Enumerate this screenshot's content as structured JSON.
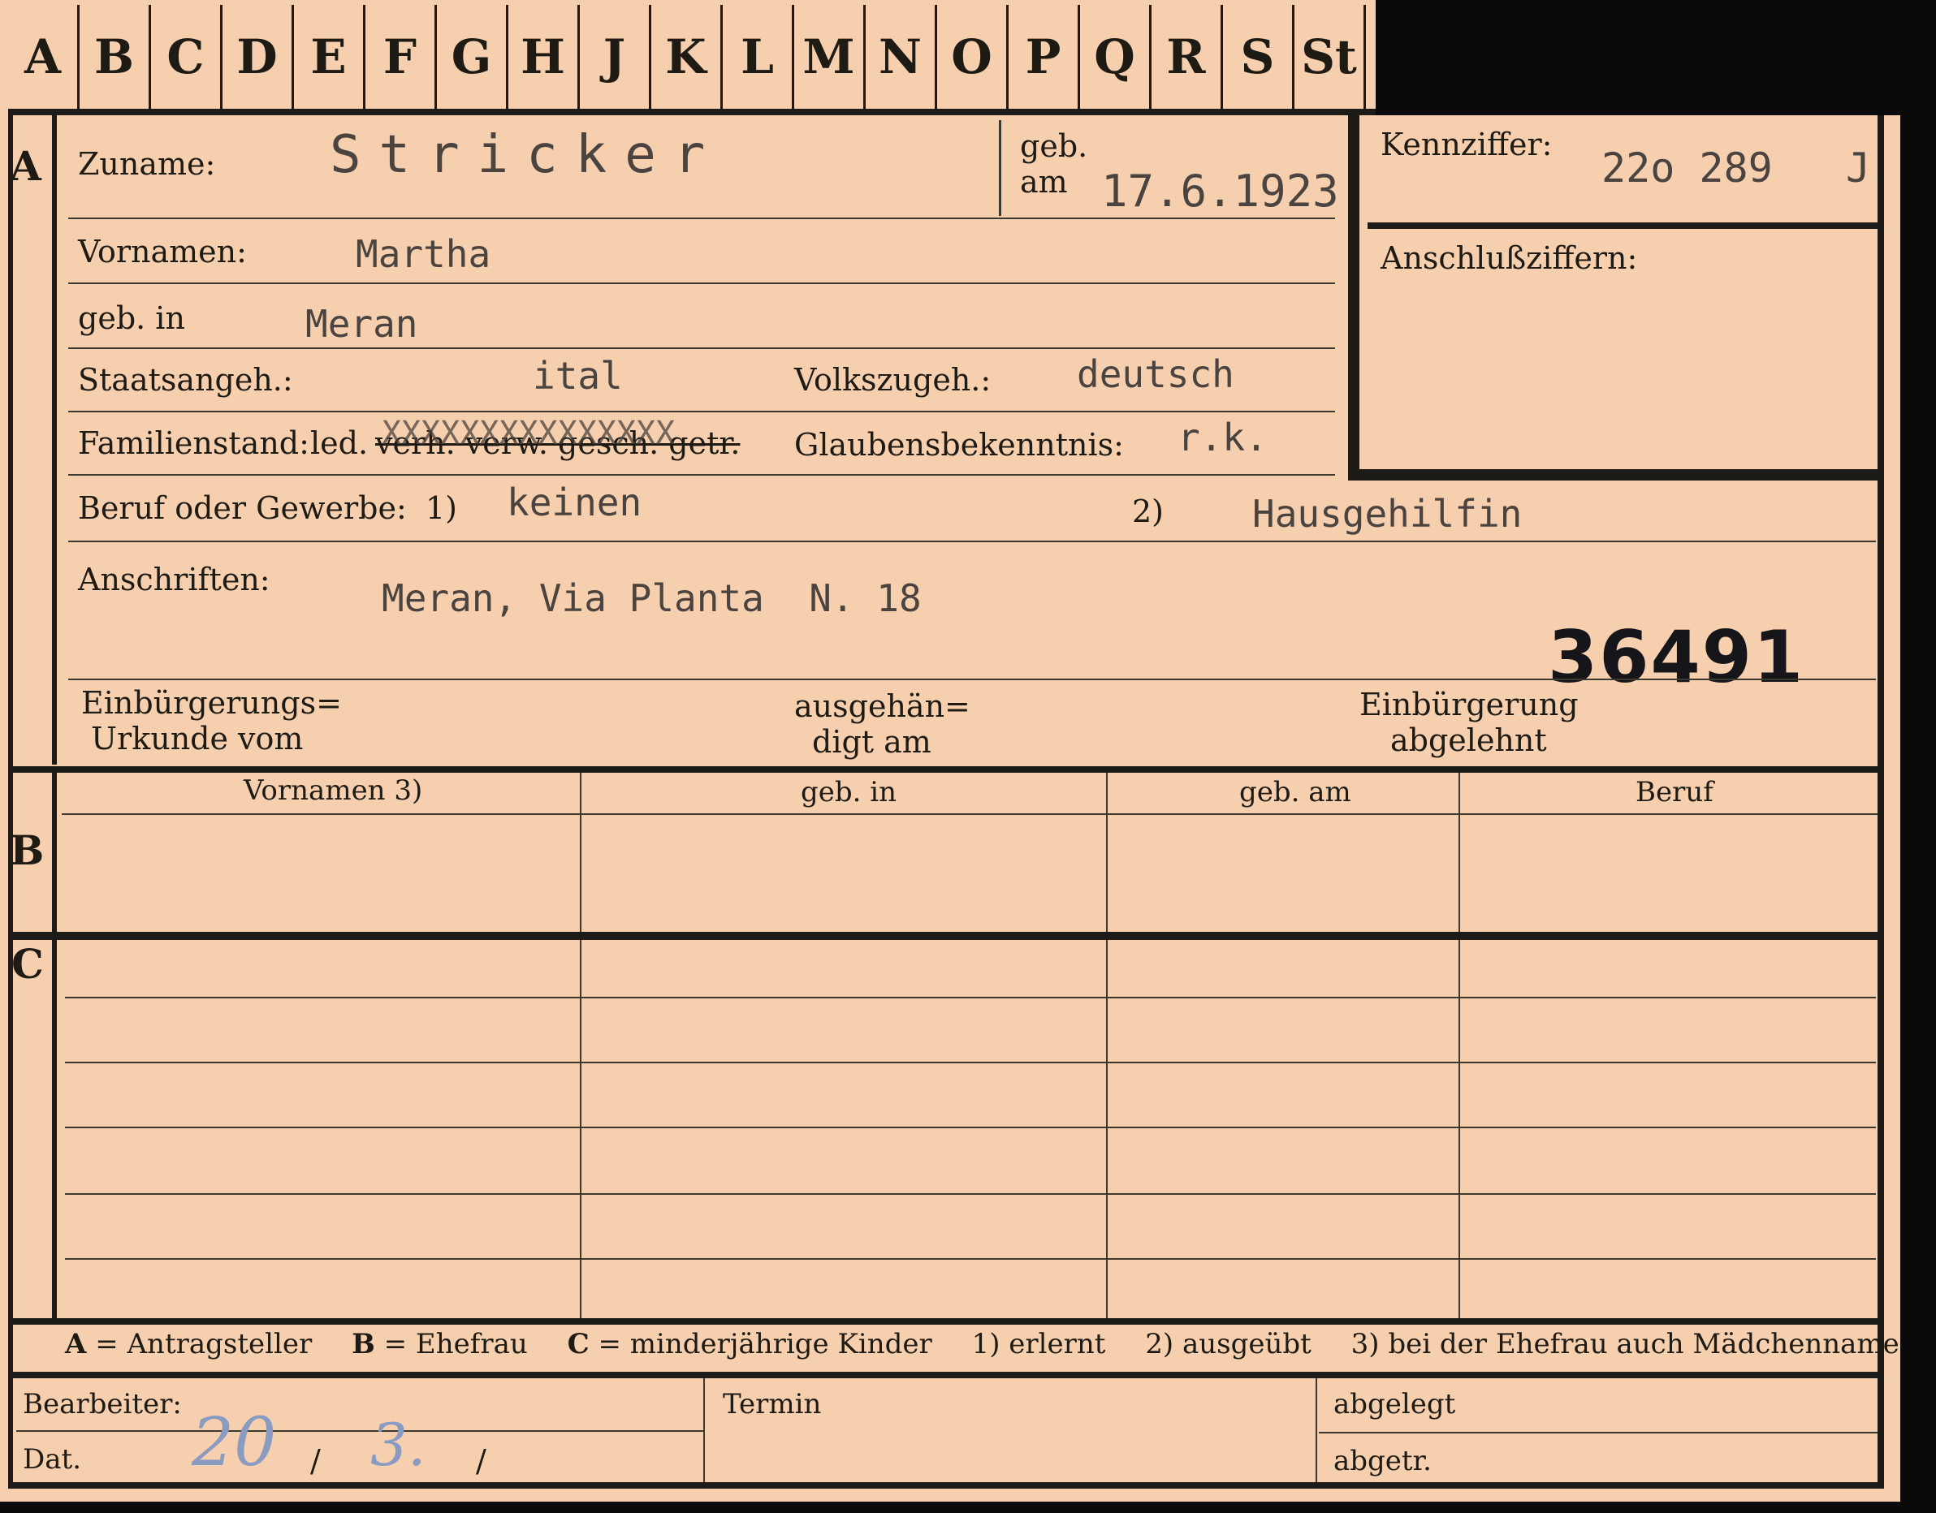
{
  "tabs": [
    "A",
    "B",
    "C",
    "D",
    "E",
    "F",
    "G",
    "H",
    "J",
    "K",
    "L",
    "M",
    "N",
    "O",
    "P",
    "Q",
    "R",
    "S",
    "St"
  ],
  "side_labels": {
    "a": "A",
    "b": "B",
    "c": "C"
  },
  "labels": {
    "zuname": "Zuname:",
    "geb_am": "geb.",
    "geb_am_2": "am",
    "kennziffer": "Kennziffer:",
    "anschlussziffern": "Anschlußziffern:",
    "vornamen": "Vornamen:",
    "geb_in": "geb. in",
    "staatsangeh": "Staatsangeh.:",
    "volkszugeh": "Volkszugeh.:",
    "familienstand": "Familienstand:",
    "familienstand_option": "led.",
    "familienstand_struck": "verh. verw. gesch. getr.",
    "glaubensbekenntnis": "Glaubensbekenntnis:",
    "beruf": "Beruf oder Gewerbe:",
    "beruf_note1": "1)",
    "beruf_note2": "2)",
    "anschriften": "Anschriften:",
    "einbuergerung_1": "Einbürgerungs=",
    "einbuergerung_2": "Urkunde vom",
    "ausgehaend_1": "ausgehän=",
    "ausgehaend_2": "digt am",
    "abgelehnt_1": "Einbürgerung",
    "abgelehnt_2": "abgelehnt"
  },
  "values": {
    "zuname": "Stricker",
    "geb_am": "17.6.1923.",
    "kennziffer": "22o 289   J",
    "vornamen": "Martha",
    "geb_in": "Meran",
    "staatsangeh": "ital",
    "volkszugeh": "deutsch",
    "familienstand_overwrite": "XXXXXXXXXXXXXXX",
    "glaubensbekenntnis": "r.k.",
    "beruf_erlernt": "keinen",
    "beruf_ausgeuebt": "Hausgehilfin",
    "anschrift": "Meran, Via Planta  N. 18",
    "stamp_number": "36491"
  },
  "table": {
    "headers": [
      "Vornamen 3)",
      "geb. in",
      "geb. am",
      "Beruf"
    ]
  },
  "legend": {
    "a_key": "A",
    "a_val": "= Antragsteller",
    "b_key": "B",
    "b_val": "= Ehefrau",
    "c_key": "C",
    "c_val": "= minderjährige Kinder",
    "n1": "1) erlernt",
    "n2": "2) ausgeübt",
    "n3": "3) bei der Ehefrau auch Mädchenname"
  },
  "footer": {
    "bearbeiter": "Bearbeiter:",
    "dat": "Dat.",
    "dat_day": "20",
    "dat_month": "3.",
    "sep": "/",
    "termin": "Termin",
    "abgelegt": "abgelegt",
    "abgetr": "abgetr."
  }
}
